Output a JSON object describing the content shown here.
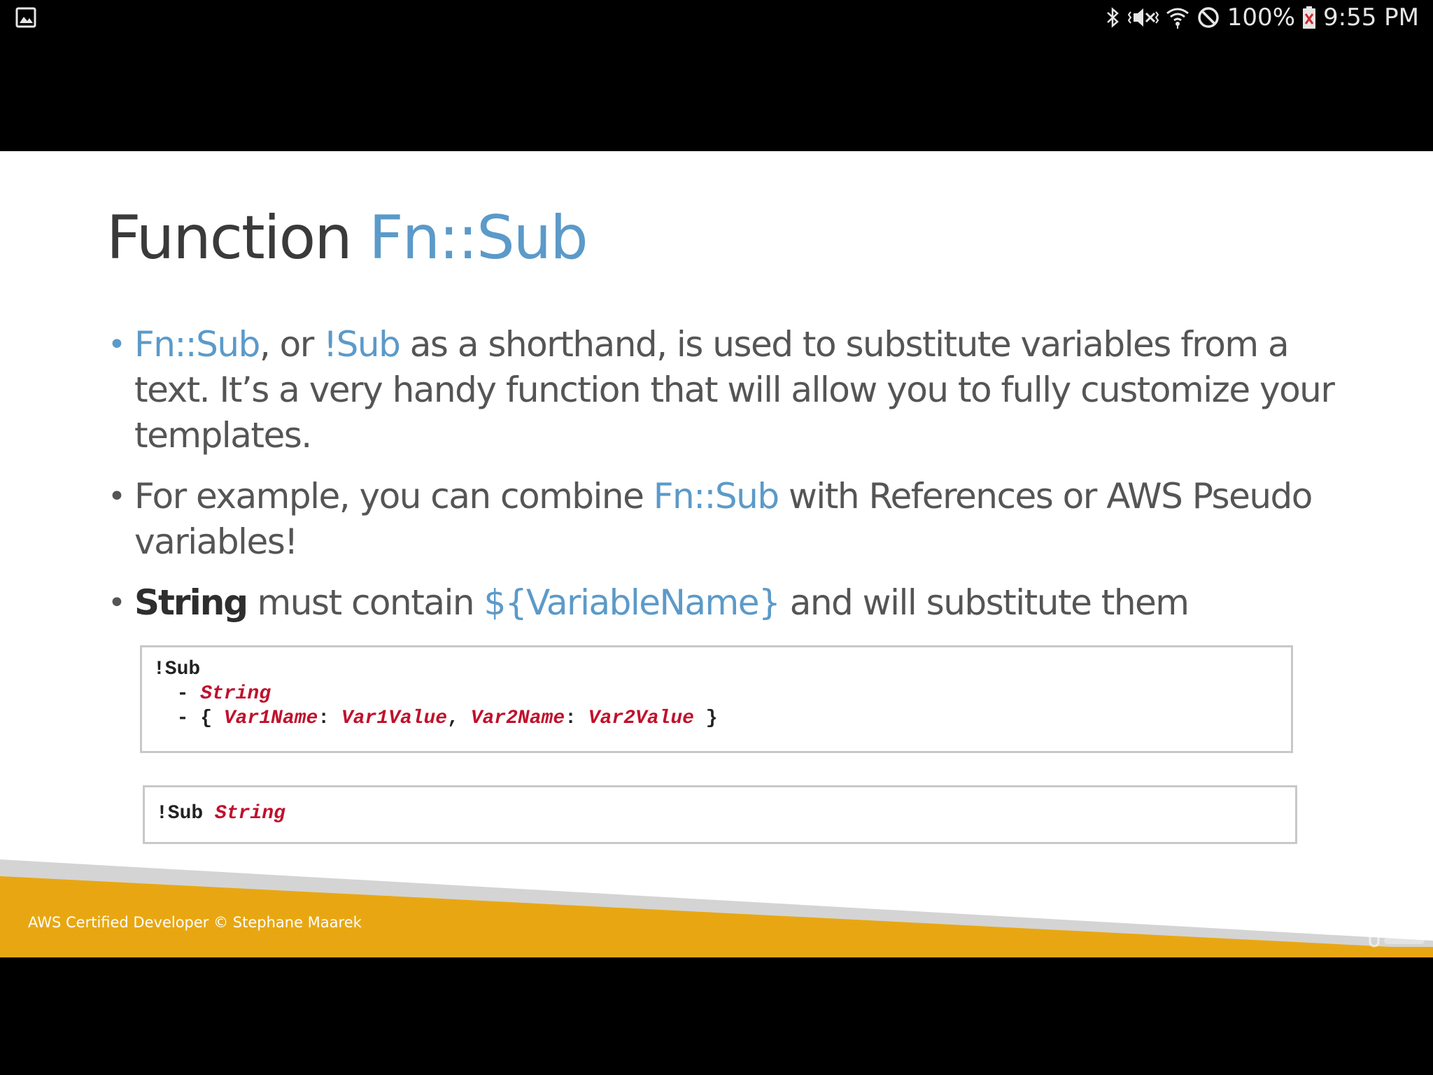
{
  "status_bar": {
    "battery_percent": "100%",
    "time": "9:55 PM",
    "icons": [
      "gallery-icon",
      "bluetooth-icon",
      "vibrate-icon",
      "wifi-icon",
      "do-not-disturb-icon",
      "battery-icon"
    ]
  },
  "slide": {
    "title": {
      "prefix": "Function ",
      "highlight": "Fn::Sub"
    },
    "bullets": [
      {
        "parts": [
          {
            "text": "Fn::Sub",
            "style": "highlight"
          },
          {
            "text": ", or ",
            "style": "normal"
          },
          {
            "text": "!Sub",
            "style": "highlight"
          },
          {
            "text": " as a shorthand, is used to substitute variables from a text. It’s a very handy function that will allow you to fully customize your templates.",
            "style": "normal"
          }
        ]
      },
      {
        "parts": [
          {
            "text": "For example, you can combine ",
            "style": "normal"
          },
          {
            "text": "Fn::Sub",
            "style": "highlight"
          },
          {
            "text": " with References or AWS Pseudo variables!",
            "style": "normal"
          }
        ]
      },
      {
        "parts": [
          {
            "text": "String",
            "style": "strong"
          },
          {
            "text": " must contain ",
            "style": "normal"
          },
          {
            "text": "${VariableName}",
            "style": "highlight"
          },
          {
            "text": " and will substitute them",
            "style": "normal"
          }
        ]
      }
    ],
    "code_block_1": {
      "line1": "!Sub",
      "line2_dash": "  - ",
      "line2_value": "String",
      "line3_prefix": "  - { ",
      "var1_name": "Var1Name",
      "colon1": ": ",
      "var1_value": "Var1Value",
      "comma": ", ",
      "var2_name": "Var2Name",
      "colon2": ": ",
      "var2_value": "Var2Value",
      "line3_suffix": " }"
    },
    "code_block_2": {
      "keyword": "!Sub ",
      "value": "String"
    },
    "footer": "AWS Certified Developer © Stephane Maarek",
    "colors": {
      "accent_blue": "#5b9ac9",
      "footer_orange": "#e8a712",
      "code_red": "#c0102c"
    }
  }
}
